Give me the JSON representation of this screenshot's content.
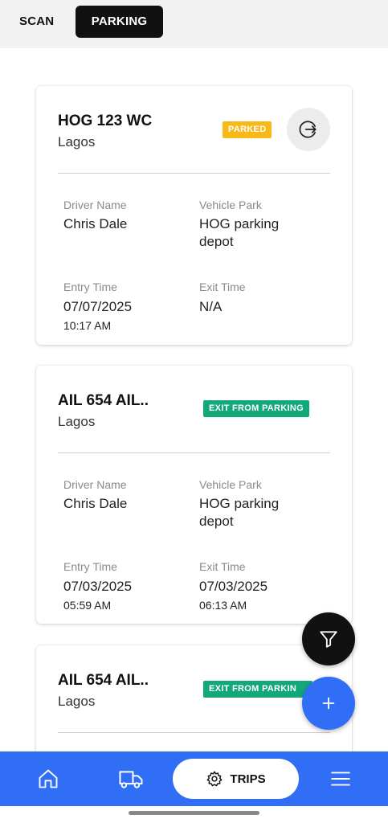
{
  "tabs": {
    "scan": "SCAN",
    "parking": "PARKING"
  },
  "labels": {
    "driver_name": "Driver Name",
    "vehicle_park": "Vehicle Park",
    "entry_time": "Entry Time",
    "exit_time": "Exit Time"
  },
  "cards": [
    {
      "plate": "HOG 123 WC",
      "city": "Lagos",
      "status": "PARKED",
      "driver": "Chris Dale",
      "park_line1": "HOG parking",
      "park_line2": "depot",
      "entry_date": "07/07/2025",
      "entry_time": "10:17 AM",
      "exit_date": "N/A",
      "exit_time": ""
    },
    {
      "plate": "AIL 654 AIL..",
      "city": "Lagos",
      "status": "EXIT FROM PARKING",
      "driver": "Chris Dale",
      "park_line1": "HOG parking",
      "park_line2": "depot",
      "entry_date": "07/03/2025",
      "entry_time": "05:59 AM",
      "exit_date": "07/03/2025",
      "exit_time": "06:13 AM"
    },
    {
      "plate": "AIL 654 AIL..",
      "city": "Lagos",
      "status": "EXIT FROM PARKIN"
    }
  ],
  "bottom_nav": {
    "trips_label": "TRIPS"
  },
  "colors": {
    "accent_blue": "#2f6ef5",
    "parked_yellow": "#f7b91a",
    "exit_green": "#12a87a",
    "dark": "#111111"
  },
  "icons": [
    "exit-icon",
    "filter-icon",
    "plus-icon",
    "home-icon",
    "truck-icon",
    "gear-icon",
    "menu-icon"
  ]
}
